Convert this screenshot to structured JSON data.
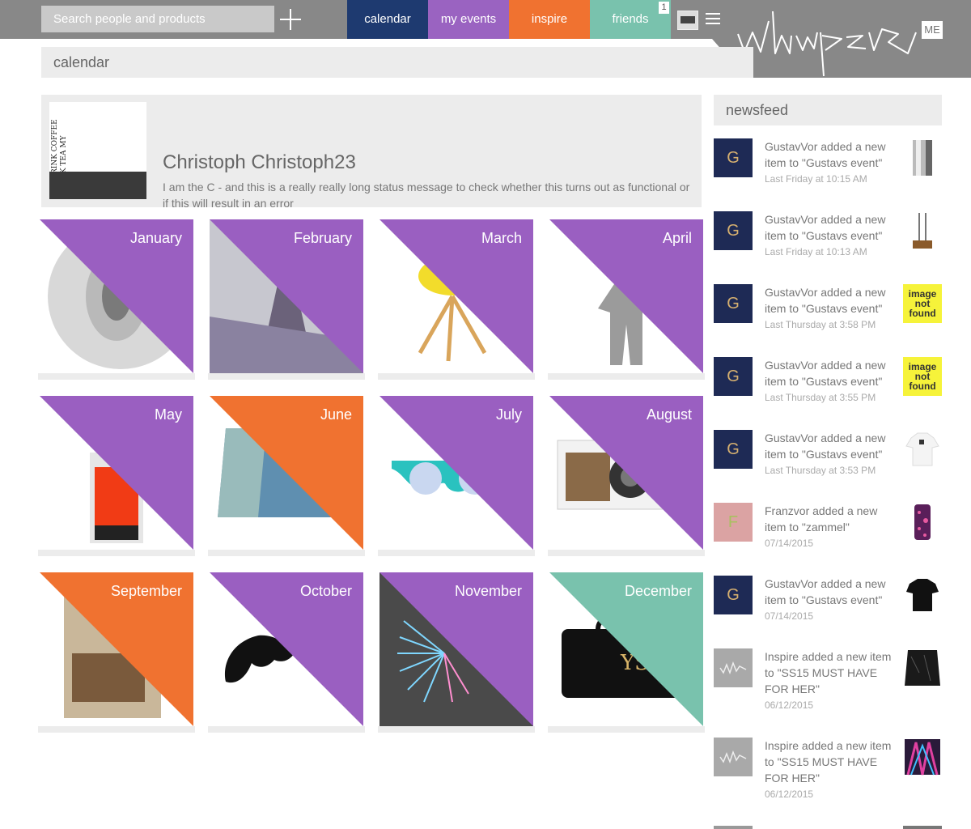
{
  "topbar": {
    "search_placeholder": "Search people and products",
    "nav": [
      {
        "label": "calendar",
        "color": "#1e3a70"
      },
      {
        "label": "my events",
        "color": "#9a63c1"
      },
      {
        "label": "inspire",
        "color": "#f07230"
      },
      {
        "label": "friends",
        "color": "#79c2ad",
        "badge": "1"
      }
    ],
    "logo_text": "whisper",
    "me_label": "ME"
  },
  "calendar_header": "calendar",
  "profile": {
    "name": "Christoph Christoph23",
    "status": "I am the C - and this is a really really long status message to check whether this turns out as functional or if this will result in an error",
    "image_text": "YOU DRINK COFFEE I DRINK TEA MY DEAR."
  },
  "months": [
    {
      "label": "January",
      "color": "#9a5fc1"
    },
    {
      "label": "February",
      "color": "#9a5fc1"
    },
    {
      "label": "March",
      "color": "#9a5fc1"
    },
    {
      "label": "April",
      "color": "#9a5fc1"
    },
    {
      "label": "May",
      "color": "#9a5fc1"
    },
    {
      "label": "June",
      "color": "#f07230"
    },
    {
      "label": "July",
      "color": "#9a5fc1"
    },
    {
      "label": "August",
      "color": "#9a5fc1"
    },
    {
      "label": "September",
      "color": "#f07230"
    },
    {
      "label": "October",
      "color": "#9a5fc1"
    },
    {
      "label": "November",
      "color": "#9a5fc1"
    },
    {
      "label": "December",
      "color": "#79c2ad"
    }
  ],
  "newsfeed": {
    "title": "newsfeed",
    "items": [
      {
        "avatar": "G",
        "avatar_color": "#1e2a55",
        "text": "GustavVor added a new item to \"Gustavs event\"",
        "time": "Last Friday at 10:15 AM",
        "thumb": "vase"
      },
      {
        "avatar": "G",
        "avatar_color": "#1e2a55",
        "text": "GustavVor added a new item to \"Gustavs event\"",
        "time": "Last Friday at 10:13 AM",
        "thumb": "stand"
      },
      {
        "avatar": "G",
        "avatar_color": "#1e2a55",
        "text": "GustavVor added a new item to \"Gustavs event\"",
        "time": "Last Thursday at 3:58 PM",
        "thumb": "notfound",
        "thumb_text": "image not found"
      },
      {
        "avatar": "G",
        "avatar_color": "#1e2a55",
        "text": "GustavVor added a new item to \"Gustavs event\"",
        "time": "Last Thursday at 3:55 PM",
        "thumb": "notfound",
        "thumb_text": "image not found"
      },
      {
        "avatar": "G",
        "avatar_color": "#1e2a55",
        "text": "GustavVor added a new item to \"Gustavs event\"",
        "time": "Last Thursday at 3:53 PM",
        "thumb": "shirt"
      },
      {
        "avatar": "F",
        "avatar_color": "#dba3a3",
        "text": "Franzvor added a new item to \"zammel\"",
        "time": "07/14/2015",
        "thumb": "phonecase"
      },
      {
        "avatar": "G",
        "avatar_color": "#1e2a55",
        "text": "GustavVor added a new item to \"Gustavs event\"",
        "time": "07/14/2015",
        "thumb": "tee"
      },
      {
        "avatar": "whisper",
        "avatar_color": "#a9a9a9",
        "text": "Inspire added a new item to \"SS15 MUST HAVE FOR HER\"",
        "time": "06/12/2015",
        "thumb": "skirt"
      },
      {
        "avatar": "whisper",
        "avatar_color": "#a9a9a9",
        "text": "Inspire added a new item to \"SS15 MUST HAVE FOR HER\"",
        "time": "06/12/2015",
        "thumb": "print"
      }
    ]
  }
}
